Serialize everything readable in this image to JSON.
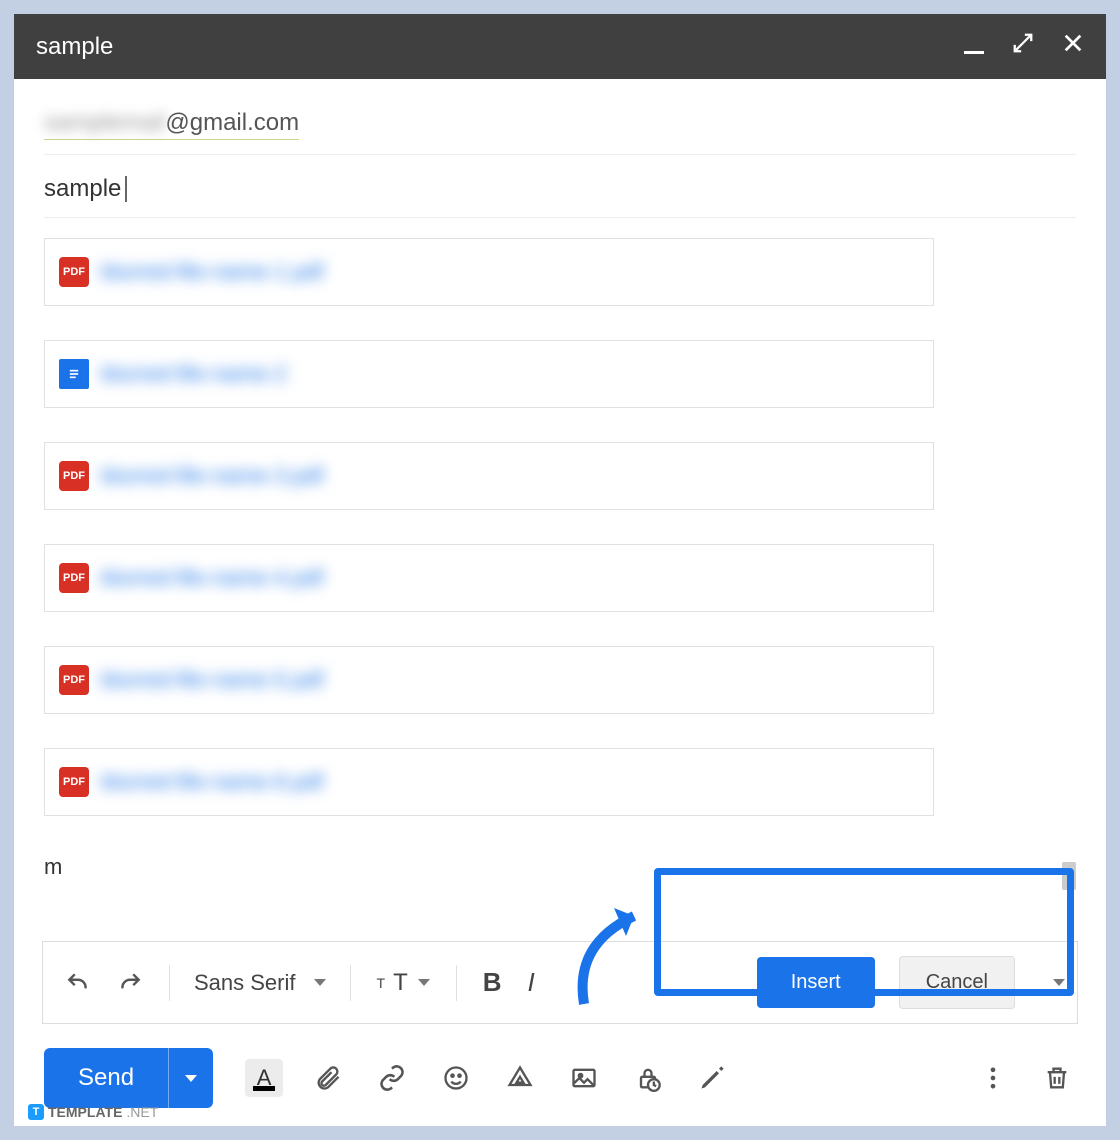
{
  "window": {
    "title": "sample"
  },
  "recipients": {
    "blurred_prefix": "samplemail",
    "suffix": "@gmail.com"
  },
  "subject": {
    "text": "sample"
  },
  "attachments": [
    {
      "type": "pdf",
      "icon_label": "PDF",
      "name": "blurred-file-name-1.pdf"
    },
    {
      "type": "doc",
      "icon_label": "DOC",
      "name": "blurred-file-name-2"
    },
    {
      "type": "pdf",
      "icon_label": "PDF",
      "name": "blurred-file-name-3.pdf"
    },
    {
      "type": "pdf",
      "icon_label": "PDF",
      "name": "blurred-file-name-4.pdf"
    },
    {
      "type": "pdf",
      "icon_label": "PDF",
      "name": "blurred-file-name-5.pdf"
    },
    {
      "type": "pdf",
      "icon_label": "PDF",
      "name": "blurred-file-name-6.pdf"
    }
  ],
  "body_partial": "m",
  "format_bar": {
    "font": "Sans Serif",
    "bold": "B",
    "italic": "I"
  },
  "dialog": {
    "insert": "Insert",
    "cancel": "Cancel"
  },
  "send": {
    "label": "Send"
  },
  "watermark": {
    "badge": "T",
    "brand": "TEMPLATE",
    "suffix": ".NET"
  }
}
